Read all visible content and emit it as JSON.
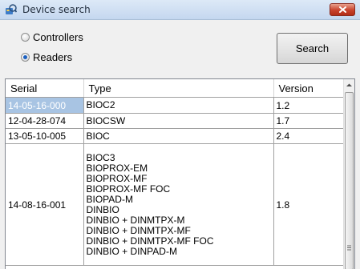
{
  "window": {
    "title": "Device search"
  },
  "options": [
    {
      "label": "Controllers",
      "selected": false
    },
    {
      "label": "Readers",
      "selected": true
    }
  ],
  "search_label": "Search",
  "table": {
    "columns": [
      "Serial",
      "Type",
      "Version"
    ],
    "rows": [
      {
        "serial": "14-05-16-000",
        "types": [
          "BIOC2"
        ],
        "version": "1.2",
        "selected": true
      },
      {
        "serial": "12-04-28-074",
        "types": [
          "BIOCSW"
        ],
        "version": "1.7"
      },
      {
        "serial": "13-05-10-005",
        "types": [
          "BIOC"
        ],
        "version": "2.4"
      },
      {
        "serial": "14-08-16-001",
        "types": [
          "BIOC3",
          "BIOPROX-EM",
          "BIOPROX-MF",
          "BIOPROX-MF FOC",
          "BIOPAD-M",
          "DINBIO",
          "DINBIO + DINMTPX-M",
          "DINBIO + DINMTPX-MF",
          "DINBIO + DINMTPX-MF FOC",
          "DINBIO + DINPAD-M"
        ],
        "version": "1.8"
      }
    ]
  },
  "colors": {
    "selection": "#a8c4e3",
    "close_button": "#c8422c",
    "radio_dot": "#1b5fbf"
  }
}
